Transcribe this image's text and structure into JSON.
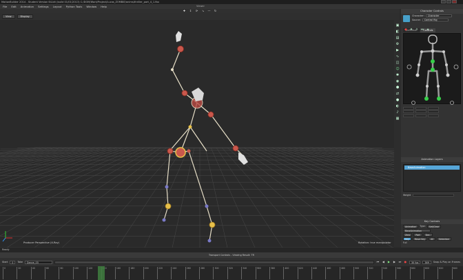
{
  "window": {
    "title": "MotionBuilder 2014 - Student Version   64-bit (build 01/01/2013)   C:/DOM/Work/Project/Lucas_ZOMBIE/anims/thriller_part_4_1.fbx"
  },
  "menu": [
    "File",
    "Edit",
    "Animation",
    "Settings",
    "Layout",
    "Python Tools",
    "Window",
    "Help"
  ],
  "toolbar": {
    "label": "Viewer"
  },
  "viewport_buttons": {
    "view": "View",
    "display": "Display"
  },
  "viewport": {
    "perspective_label": "Producer Perspective (X-Ray)",
    "rotation_label": "Rotation: true manipulator"
  },
  "character_controls": {
    "title": "Character Controls",
    "character_label": "Character:",
    "character_value": "Character",
    "source_label": "Source:",
    "source_value": "Control Rig",
    "tabs": [
      "Definition",
      "Controls"
    ]
  },
  "animation_layers": {
    "title": "Animation Layers",
    "base_layer": "BaseAnimation",
    "weight_label": "Weight"
  },
  "key_controls": {
    "title": "Key Controls",
    "buttons_row1": [
      "Animation",
      "Type:",
      "Set/Clear"
    ],
    "row2_label": "BaseAnimation",
    "row3_buttons": [
      "Zero",
      "Part",
      "Dec."
    ],
    "row4_buttons": [
      "Key",
      "Move Key",
      "All",
      "Selection"
    ],
    "filter_label": "Full"
  },
  "status": {
    "text": "Ready"
  },
  "transport": {
    "title": "Transport Controls   -   Viewing Result: TR",
    "start_label": "Start",
    "take_label": "Take",
    "take_value": "Dance_03",
    "fps_value": "30 fps",
    "snap_label": "Snap & Play on Frames",
    "frame_value": "0",
    "end_value": "369"
  },
  "timeline": {
    "ticks": [
      "0",
      "20",
      "40",
      "60",
      "80",
      "100",
      "120",
      "140",
      "160",
      "180",
      "200",
      "220",
      "240",
      "260",
      "280",
      "300",
      "320",
      "340",
      "360",
      "380",
      "400",
      "420",
      "440",
      "460",
      "480",
      "500",
      "520",
      "540",
      "560",
      "580",
      "600",
      "620",
      "640"
    ]
  },
  "colors": {
    "accent": "#56a6d8",
    "bone": "#e8e0c8",
    "joint_red": "#c9584c",
    "joint_yellow": "#e7c04a",
    "joint_blue": "#7a7ac8",
    "rig_green": "#37d04a"
  }
}
